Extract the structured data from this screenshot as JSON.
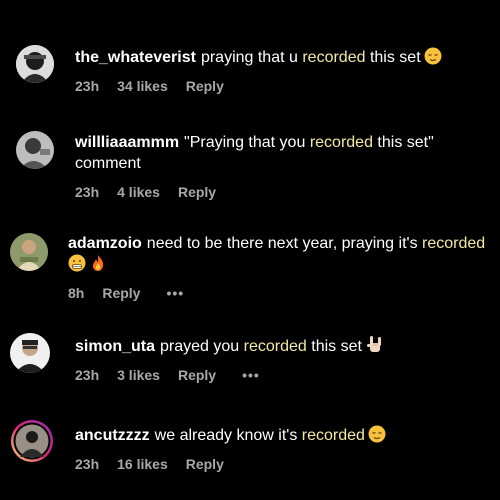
{
  "comments": [
    {
      "username": "the_whateverist",
      "before": "praying that u",
      "highlight": "recorded",
      "after": "this set",
      "time": "23h",
      "likes": "34 likes",
      "reply": "Reply"
    },
    {
      "username": "willliaaammm",
      "before": "\"Praying that you",
      "highlight": "recorded",
      "after": "this set\" comment",
      "time": "23h",
      "likes": "4 likes",
      "reply": "Reply"
    },
    {
      "username": "adamzoio",
      "before": "need to be there next year, praying it's",
      "highlight": "recorded",
      "after": "",
      "time": "8h",
      "likes": "",
      "reply": "Reply",
      "more": "•••"
    },
    {
      "username": "simon_uta",
      "before": "prayed you",
      "highlight": "recorded",
      "after": "this set",
      "time": "23h",
      "likes": "3 likes",
      "reply": "Reply",
      "more": "•••"
    },
    {
      "username": "ancutzzzz",
      "before": "we already know it's",
      "highlight": "recorded",
      "after": "",
      "time": "23h",
      "likes": "16 likes",
      "reply": "Reply"
    }
  ],
  "icons": {
    "relieved": "relieved-face-emoji",
    "grimace": "grimacing-face-emoji",
    "fire": "fire-emoji",
    "rock": "sign-of-horns-emoji"
  },
  "colors": {
    "background": "#000000",
    "text": "#ffffff",
    "meta": "#a8a8a8",
    "highlight": "#f3e9a2"
  }
}
